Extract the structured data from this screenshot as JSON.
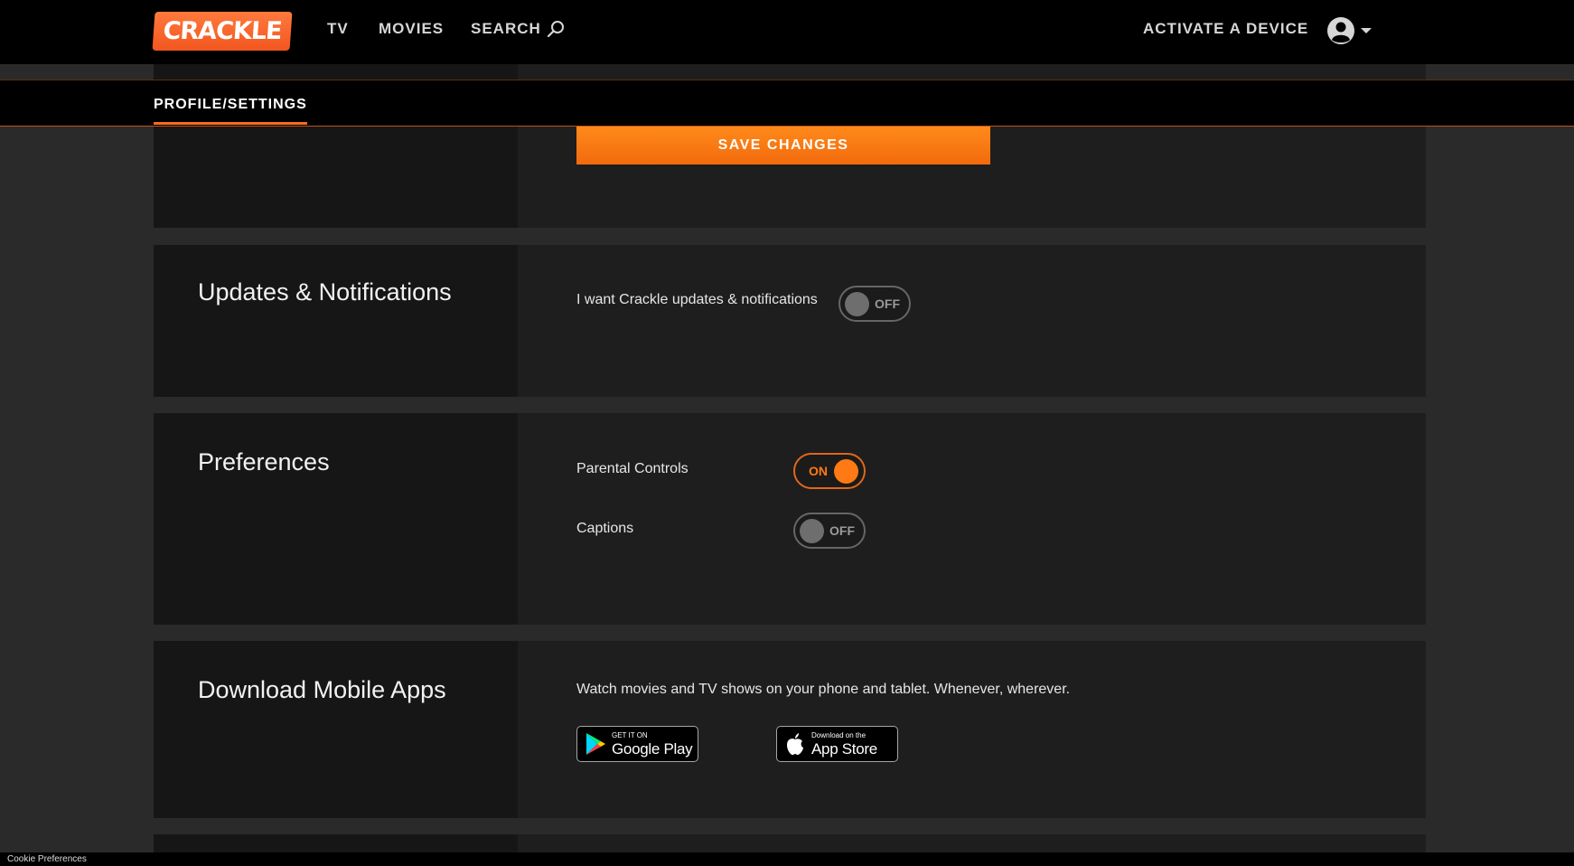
{
  "nav": {
    "logo": "CRACKLE",
    "tv": "TV",
    "movies": "MOVIES",
    "search": "SEARCH",
    "activate": "ACTIVATE A DEVICE"
  },
  "subnav": {
    "tab": "PROFILE/SETTINGS"
  },
  "save": {
    "button": "SAVE CHANGES"
  },
  "updates": {
    "title": "Updates & Notifications",
    "label": "I want Crackle updates & notifications",
    "toggle": "OFF"
  },
  "preferences": {
    "title": "Preferences",
    "parental_label": "Parental Controls",
    "parental_toggle": "ON",
    "captions_label": "Captions",
    "captions_toggle": "OFF"
  },
  "apps": {
    "title": "Download Mobile Apps",
    "description": "Watch movies and TV shows on your phone and tablet. Whenever, wherever.",
    "google_small": "GET IT ON",
    "google_big": "Google Play",
    "apple_small": "Download on the",
    "apple_big": "App Store"
  },
  "footer": {
    "cookie": "Cookie Preferences"
  },
  "colors": {
    "accent": "#ff7a14",
    "background": "#2a2a2a",
    "panel": "#1e1e1e",
    "side": "#161616"
  }
}
